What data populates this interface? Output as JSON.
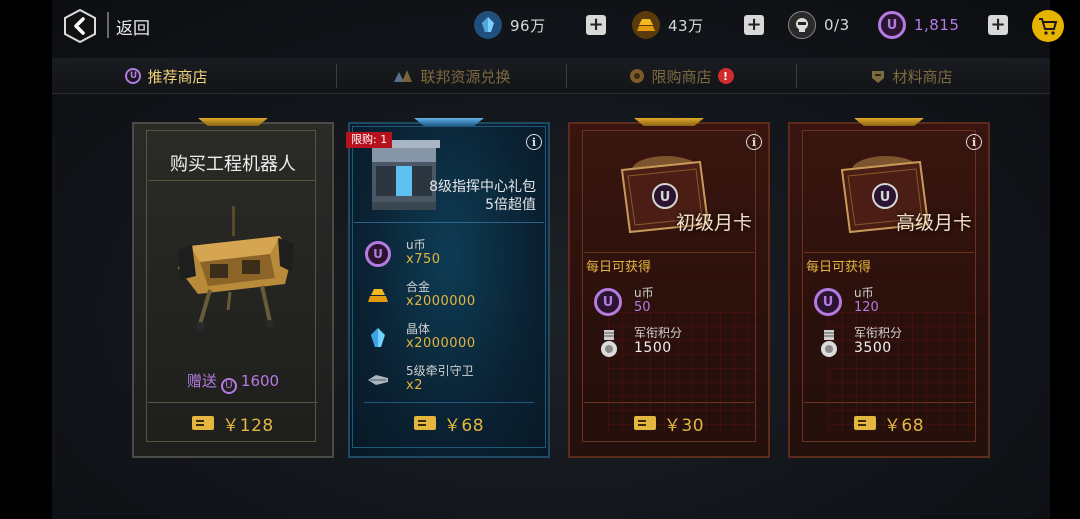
{
  "header": {
    "back_label": "返回",
    "resources": [
      {
        "name": "crystal",
        "value": "96万",
        "icon": "crystal-icon"
      },
      {
        "name": "alloy",
        "value": "43万",
        "icon": "alloy-icon"
      },
      {
        "name": "robot",
        "value": "0/3",
        "icon": "robot-head-icon"
      },
      {
        "name": "ucoin",
        "value": "1,815",
        "icon": "ucoin-icon"
      }
    ],
    "colors": {
      "accent": "#e3b640",
      "purple": "#b57be0",
      "cart": "#e6b400"
    }
  },
  "tabs": [
    {
      "label": "推荐商店",
      "active": true,
      "icon": "ucoin-icon"
    },
    {
      "label": "联邦资源兑换",
      "active": false,
      "icon": "resource-exchange-icon"
    },
    {
      "label": "限购商店",
      "active": false,
      "icon": "limited-shop-icon",
      "badge": "!"
    },
    {
      "label": "材料商店",
      "active": false,
      "icon": "material-shop-icon"
    }
  ],
  "cards": {
    "robot": {
      "title": "购买工程机器人",
      "bonus_prefix": "赠送",
      "bonus_coin": "U",
      "bonus_value": "1600",
      "price": "￥128"
    },
    "gift": {
      "limit": "限购: 1",
      "info": "i",
      "title": "8级指挥中心礼包",
      "subtitle": "5倍超值",
      "items": [
        {
          "name": "u币",
          "qty": "x750",
          "icon": "ucoin-icon"
        },
        {
          "name": "合金",
          "qty": "x2000000",
          "icon": "alloy-icon"
        },
        {
          "name": "晶体",
          "qty": "x2000000",
          "icon": "crystal-icon"
        },
        {
          "name": "5级牵引守卫",
          "qty": "x2",
          "icon": "guard-ship-icon"
        }
      ],
      "price": "￥68"
    },
    "monthly_basic": {
      "info": "i",
      "name": "初级月卡",
      "daily_label": "每日可获得",
      "coin_name": "u币",
      "coin_value": "50",
      "points_name": "军衔积分",
      "points_value": "1500",
      "price": "￥30"
    },
    "monthly_premium": {
      "info": "i",
      "name": "高级月卡",
      "daily_label": "每日可获得",
      "coin_name": "u币",
      "coin_value": "120",
      "points_name": "军衔积分",
      "points_value": "3500",
      "price": "￥68"
    }
  }
}
